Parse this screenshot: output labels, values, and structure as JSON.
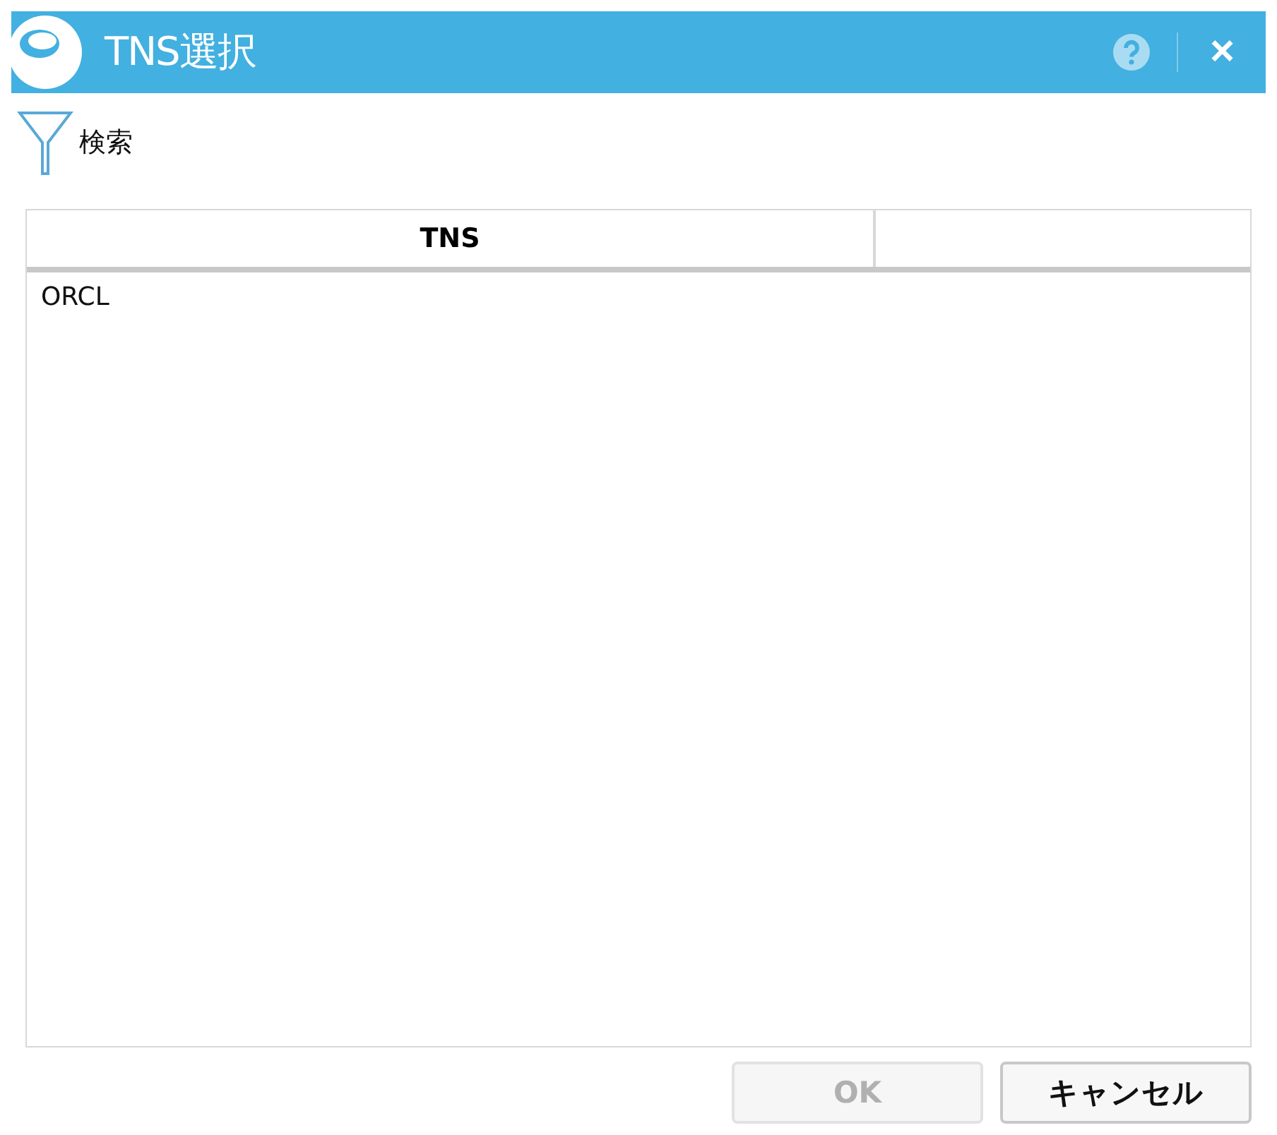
{
  "window": {
    "title": "TNS選択",
    "close": "×"
  },
  "search": {
    "label": "検索"
  },
  "table": {
    "columns": [
      "TNS"
    ],
    "rows": [
      {
        "cells": [
          "ORCL"
        ],
        "selected": false
      }
    ]
  },
  "buttons": [
    {
      "label": "OK",
      "disabled": true
    },
    {
      "label": "キャンセル",
      "disabled": false
    }
  ]
}
